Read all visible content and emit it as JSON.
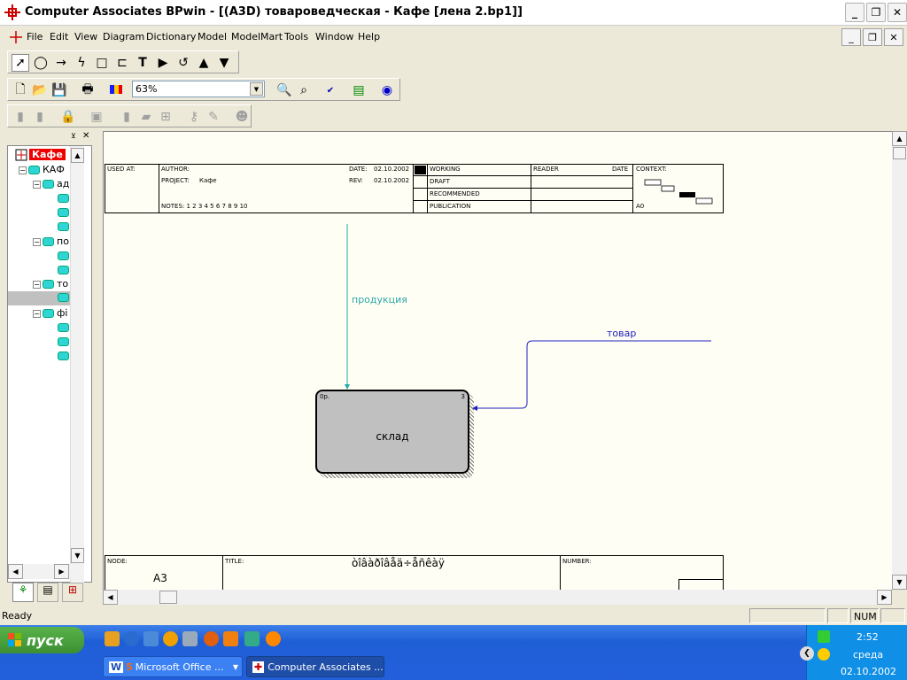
{
  "window": {
    "title": "Computer Associates BPwin - [(A3D) товароведческая - Кафе  [лена 2.bp1]]"
  },
  "menu": {
    "items": [
      "File",
      "Edit",
      "View",
      "Diagram",
      "Dictionary",
      "Model",
      "ModelMart",
      "Tools",
      "Window",
      "Help"
    ]
  },
  "toolbar": {
    "zoom_value": "63%"
  },
  "tree": {
    "root_label": "Кафе",
    "top_item": "КАФ",
    "groups": [
      {
        "label": "ад",
        "children": 3
      },
      {
        "label": "по",
        "children": 2
      },
      {
        "label": "то",
        "children": 1
      },
      {
        "label": "фі",
        "children": 3
      }
    ]
  },
  "diagram": {
    "header": {
      "used_at": "USED AT:",
      "author": "AUTHOR:",
      "project_label": "PROJECT:",
      "project_value": "Кафе",
      "date_label": "DATE:",
      "date_value": "02.10.2002",
      "rev_label": "REV:",
      "rev_value": "02.10.2002",
      "notes": "NOTES:  1  2  3  4  5  6  7  8  9  10",
      "working": "WORKING",
      "draft": "DRAFT",
      "recommended": "RECOMMENDED",
      "publication": "PUBLICATION",
      "reader": "READER",
      "date": "DATE",
      "context": "CONTEXT:",
      "context_node": "A0"
    },
    "box": {
      "label": "склад",
      "number": "3",
      "cost": "0р."
    },
    "arrows": {
      "top": "продукция",
      "right": "товар"
    },
    "footer": {
      "node_label": "NODE:",
      "node_value": "A3",
      "title_label": "TITLE:",
      "title_value": "òîâàðîâåä÷åñêàÿ",
      "number_label": "NUMBER:"
    }
  },
  "status": {
    "text": "Ready",
    "num": "NUM"
  },
  "taskbar": {
    "start": "пуск",
    "tasks": [
      {
        "label": "Microsoft Office ...",
        "count": "5"
      },
      {
        "label": "Computer Associates ..."
      }
    ],
    "clock": {
      "time": "2:52",
      "day": "среда",
      "date": "02.10.2002"
    }
  },
  "colors": {
    "arrow": "#2aa7a7",
    "box": "#c0c0c0",
    "canvas": "#fffef4",
    "arrow2": "#2020c0"
  }
}
